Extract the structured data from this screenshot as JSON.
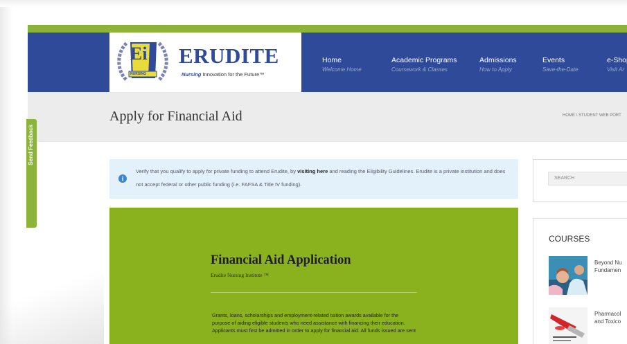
{
  "logo": {
    "monogram": "Ei",
    "badge": "NURSING",
    "name": "ERUDITE",
    "tagline_highlight": "Nursing",
    "tagline_rest": "Innovation for the Future™"
  },
  "nav": [
    {
      "title": "Home",
      "subtitle": "Welcome Home"
    },
    {
      "title": "Academic Programs",
      "subtitle": "Coursework & Classes"
    },
    {
      "title": "Admissions",
      "subtitle": "How to Apply"
    },
    {
      "title": "Events",
      "subtitle": "Save-the-Date"
    },
    {
      "title": "e-Shop",
      "subtitle": "Visit Ar"
    }
  ],
  "page": {
    "title": "Apply for Financial Aid",
    "breadcrumb": "HOME \\ STUDENT WEB PORT"
  },
  "notice": {
    "text_before": "Verify that you qualify to apply for private funding to attend Erudite, by ",
    "link": "visiting here",
    "text_after": " and reading the Eligibility Guidelines. Erudite is a private institution and does not accept federal or other public funding (i.e. FAFSA & Title IV funding)."
  },
  "form": {
    "title": "Financial Aid Application",
    "subtitle": "Erudite Nursing Institute ™",
    "body": "Grants, loans, scholarships and employment-related tuition awards available for the purpose of aiding eligible students who need assistance with financing their education. Applicants must first be admitted in order to apply for financial aid. All funds issued are sent"
  },
  "sidebar": {
    "search_placeholder": "SEARCH",
    "courses_title": "COURSES",
    "courses": [
      {
        "line1": "Beyond Nu",
        "line2": "Fundamen"
      },
      {
        "line1": "Pharmacol",
        "line2": "and Toxico"
      }
    ]
  },
  "feedback_tab": "Send Feedback",
  "colors": {
    "brand_blue": "#2f4a99",
    "brand_green": "#8db43a",
    "panel_green": "#8ab21e",
    "notice_bg": "#e2f1fa"
  }
}
